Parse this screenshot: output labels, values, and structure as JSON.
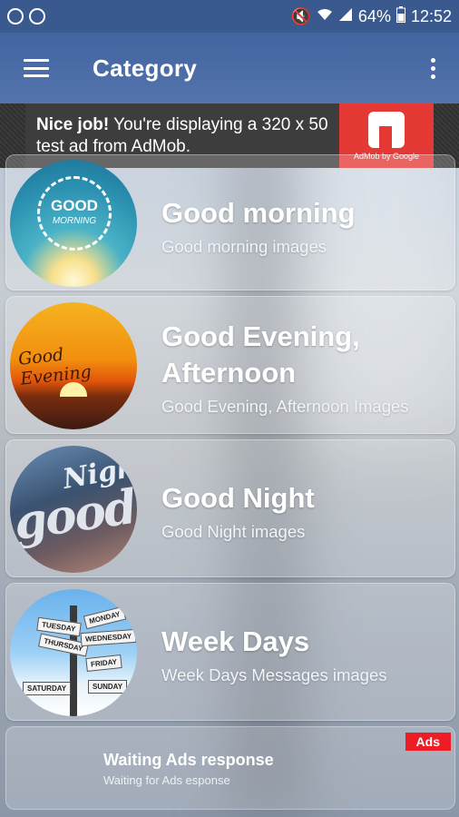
{
  "status_bar": {
    "battery": "64%",
    "time": "12:52",
    "icons": [
      "app-notification-icon",
      "sync-icon",
      "mute-icon",
      "wifi-icon",
      "signal-icon",
      "battery-icon"
    ]
  },
  "app_bar": {
    "title": "Category",
    "menu_icon": "hamburger-menu-icon",
    "overflow_icon": "more-vert-icon"
  },
  "ad_banner": {
    "bold": "Nice job!",
    "text": " You're displaying a 320 x 50 test ad from AdMob.",
    "logo_text": "AdMob by Google"
  },
  "categories": [
    {
      "title": "Good morning",
      "subtitle": "Good morning images",
      "thumb_text": "GOOD",
      "thumb_text2": "MORNING"
    },
    {
      "title": "Good Evening, Afternoon",
      "subtitle": "Good Evening, Afternoon Images",
      "thumb_text": "Good Evening"
    },
    {
      "title": "Good Night",
      "subtitle": "Good Night images",
      "thumb_text": "Night",
      "thumb_text2": "good"
    },
    {
      "title": "Week Days",
      "subtitle": "Week Days Messages images",
      "signs": [
        "TUESDAY",
        "MONDAY",
        "THURSDAY",
        "WEDNESDAY",
        "FRIDAY",
        "SATURDAY",
        "SUNDAY"
      ]
    }
  ],
  "ad_card": {
    "badge": "Ads",
    "title": "Waiting Ads response",
    "subtitle": "Waiting for Ads esponse"
  },
  "colors": {
    "app_bar": "#4264a0",
    "ad_badge": "#ee1c25",
    "admob_red": "#e53935"
  }
}
